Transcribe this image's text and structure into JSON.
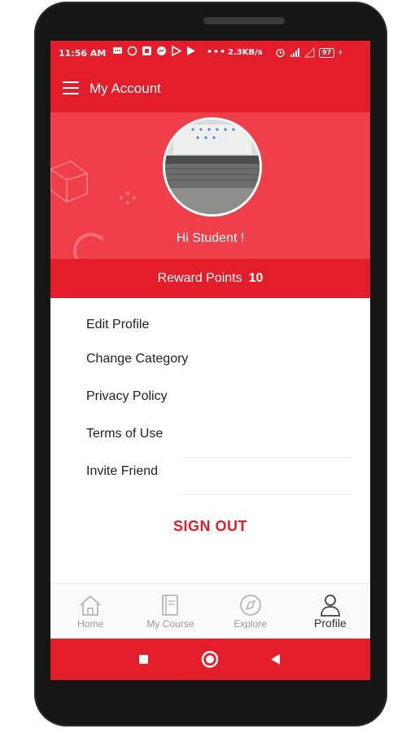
{
  "status_bar": {
    "time": "11:56 AM",
    "network_speed": "2.3KB/s",
    "battery": "97",
    "dots": "•••"
  },
  "app_bar": {
    "title": "My Account",
    "menu_icon": "hamburger-icon"
  },
  "profile": {
    "greeting": "Hi Student !",
    "avatar_icon": "profile-photo"
  },
  "reward": {
    "label": "Reward Points",
    "points": "10"
  },
  "menu": {
    "items": [
      {
        "label": "Edit Profile"
      },
      {
        "label": "Change Category"
      },
      {
        "label": "Privacy Policy"
      },
      {
        "label": "Terms of Use"
      },
      {
        "label": "Invite Friend"
      }
    ],
    "sign_out": "SIGN OUT"
  },
  "bottom_nav": {
    "items": [
      {
        "label": "Home",
        "icon": "home-icon"
      },
      {
        "label": "My Course",
        "icon": "book-icon"
      },
      {
        "label": "Explore",
        "icon": "compass-icon"
      },
      {
        "label": "Profile",
        "icon": "person-icon",
        "active": true
      }
    ]
  },
  "system_nav": {
    "icons": [
      "square-icon",
      "circle-icon",
      "back-triangle-icon"
    ]
  },
  "colors": {
    "accent": "#e31e2a",
    "header": "#ef3f4a",
    "text": "#222222"
  }
}
